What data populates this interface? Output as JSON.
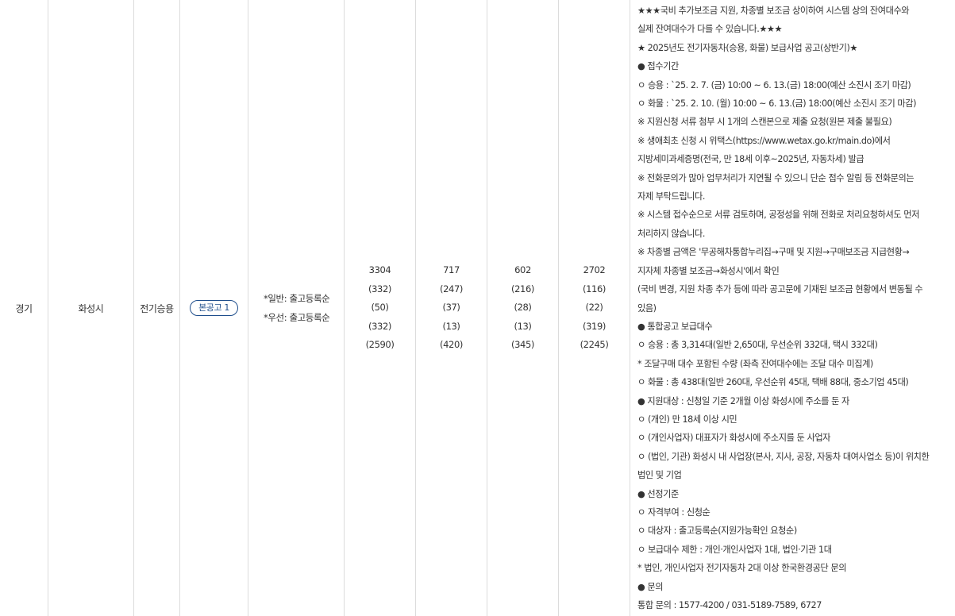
{
  "row": {
    "region": "경기",
    "city": "화성시",
    "vehicle_type": "전기승용",
    "notice_button": "본공고 1",
    "method": [
      "*일반: 출고등록순",
      "*우선: 출고등록순"
    ],
    "counts": [
      [
        "3304",
        "(332)",
        "(50)",
        "(332)",
        "(2590)"
      ],
      [
        "717",
        "(247)",
        "(37)",
        "(13)",
        "(420)"
      ],
      [
        "602",
        "(216)",
        "(28)",
        "(13)",
        "(345)"
      ],
      [
        "2702",
        "(116)",
        "(22)",
        "(319)",
        "(2245)"
      ]
    ],
    "notes": [
      "★★★국비 추가보조금 지원, 차종별 보조금 상이하여 시스템 상의 잔여대수와",
      "실제 잔여대수가 다를 수 있습니다.★★★",
      "★ 2025년도 전기자동차(승용, 화물) 보급사업 공고(상반기)★",
      "● 접수기간",
      "ㅇ 승용 : `25. 2. 7. (금) 10:00 ~ 6. 13.(금) 18:00(예산 소진시 조기 마감)",
      "ㅇ 화물 : `25. 2. 10. (월) 10:00 ~ 6. 13.(금) 18:00(예산 소진시 조기 마감)",
      "※ 지원신청 서류 첨부 시 1개의 스캔본으로 제출 요청(원본 제출 불필요)",
      "※ 생애최초 신청 시 위택스(https://www.wetax.go.kr/main.do)에서",
      "지방세미과세증명(전국, 만 18세 이후~2025년, 자동차세) 발급",
      "※ 전화문의가 많아 업무처리가 지연될 수 있으니 단순 접수 알림 등 전화문의는",
      "자제 부탁드립니다.",
      "※ 시스템 접수순으로 서류 검토하며, 공정성을 위해 전화로 처리요청하셔도 먼저",
      "처리하지 않습니다.",
      "※ 차종별 금액은 '무공해차통합누리집→구매 및 지원→구매보조금 지급현황→",
      "지자체 차종별 보조금→화성시'에서 확인",
      "(국비 변경, 지원 차종 추가 등에 따라 공고문에 기재된 보조금 현황에서 변동될 수",
      "있음)",
      "● 통합공고 보급대수",
      "ㅇ 승용 : 총 3,314대(일반 2,650대, 우선순위 332대, 택시 332대)",
      "* 조달구매 대수 포함된 수량 (좌측 잔여대수에는 조달 대수 미집계)",
      "ㅇ 화물 : 총 438대(일반 260대, 우선순위 45대, 택배 88대, 중소기업 45대)",
      "● 지원대상 : 신청일 기준 2개월 이상 화성시에 주소를 둔 자",
      "ㅇ (개인) 만 18세 이상 시민",
      "ㅇ (개인사업자) 대표자가 화성시에 주소지를 둔 사업자",
      "ㅇ (법인, 기관) 화성시 내 사업장(본사, 지사, 공장, 자동차 대여사업소 등)이 위치한",
      "법인 및 기업",
      "● 선정기준",
      "ㅇ 자격부여 : 신청순",
      "ㅇ 대상자 : 출고등록순(지원가능확인 요청순)",
      "ㅇ 보급대수 제한 : 개인·개인사업자 1대, 법인·기관 1대",
      "* 법인, 개인사업자 전기자동차 2대 이상 한국환경공단 문의",
      "● 문의",
      "통합 문의 : 1577-4200 / 031-5189-7589, 6727"
    ]
  }
}
